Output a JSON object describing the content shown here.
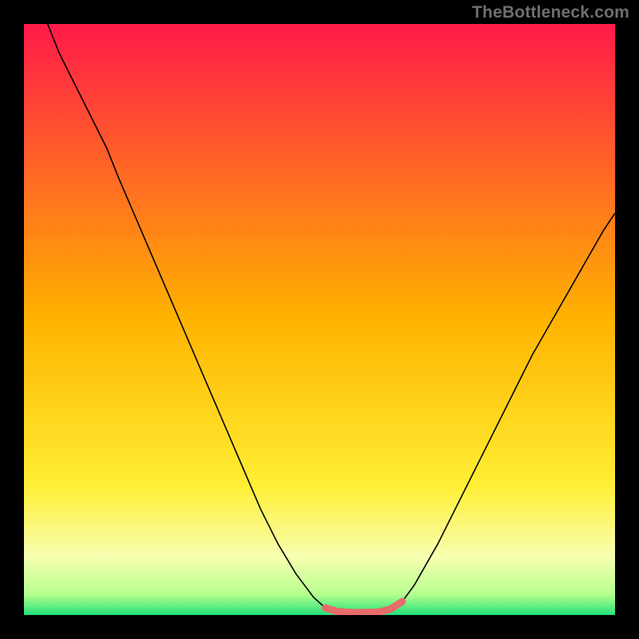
{
  "watermark": "TheBottleneck.com",
  "chart_data": {
    "type": "line",
    "title": "",
    "xlabel": "",
    "ylabel": "",
    "xlim": [
      0,
      100
    ],
    "ylim": [
      0,
      100
    ],
    "grid": false,
    "legend": false,
    "background_gradient": {
      "stops": [
        {
          "offset": 0.0,
          "color": "#ff1a4a"
        },
        {
          "offset": 0.5,
          "color": "#ffb300"
        },
        {
          "offset": 0.78,
          "color": "#ffee33"
        },
        {
          "offset": 0.9,
          "color": "#f8ffb0"
        },
        {
          "offset": 0.965,
          "color": "#b6ff8e"
        },
        {
          "offset": 1.0,
          "color": "#22e07a"
        }
      ]
    },
    "series": [
      {
        "name": "curve",
        "stroke": "#000000",
        "stroke_width": 1.6,
        "points": [
          [
            4,
            100
          ],
          [
            6,
            95
          ],
          [
            9,
            89
          ],
          [
            12,
            83
          ],
          [
            14,
            79
          ],
          [
            16,
            74
          ],
          [
            19,
            67
          ],
          [
            22,
            60
          ],
          [
            25,
            53
          ],
          [
            28,
            46
          ],
          [
            31,
            39
          ],
          [
            34,
            32
          ],
          [
            37,
            25
          ],
          [
            40,
            18
          ],
          [
            43,
            12
          ],
          [
            46,
            7
          ],
          [
            49,
            3
          ],
          [
            51,
            1.2
          ],
          [
            53,
            0.6
          ],
          [
            56,
            0.4
          ],
          [
            60,
            0.5
          ],
          [
            62,
            1.0
          ],
          [
            64,
            2.3
          ],
          [
            66,
            5
          ],
          [
            70,
            12
          ],
          [
            74,
            20
          ],
          [
            78,
            28
          ],
          [
            82,
            36
          ],
          [
            86,
            44
          ],
          [
            90,
            51
          ],
          [
            94,
            58
          ],
          [
            98,
            65
          ],
          [
            100,
            68
          ]
        ]
      },
      {
        "name": "bottleneck-highlight",
        "stroke": "#e86b6b",
        "stroke_width": 9,
        "linecap": "round",
        "points": [
          [
            51,
            1.2
          ],
          [
            53,
            0.6
          ],
          [
            56,
            0.4
          ],
          [
            60,
            0.5
          ],
          [
            62,
            1.0
          ],
          [
            64,
            2.3
          ]
        ]
      }
    ]
  }
}
